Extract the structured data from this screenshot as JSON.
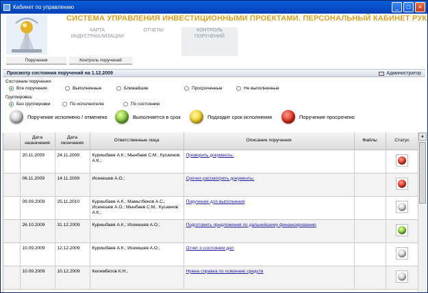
{
  "window": {
    "title": "Кабинет по управлению",
    "min": "_",
    "max": "□",
    "close": "×"
  },
  "header": {
    "app_title": "СИСТЕМА УПРАВЛЕНИЯ ИНВЕСТИЦИОННЫМИ ПРОЕКТАМИ. ПЕРСОНАЛЬНЫЙ КАБИНЕТ РУКОВОДИТЕЛЯ",
    "nav": [
      {
        "label_line1": "КАРТА",
        "label_line2": "ИНДУСТРИАЛИЗАЦИИ",
        "active": false
      },
      {
        "label_line1": "ОТЧЕТЫ",
        "label_line2": "",
        "active": false
      },
      {
        "label_line1": "КОНТРОЛЬ",
        "label_line2": "ПОРУЧЕНИЙ",
        "active": true
      }
    ]
  },
  "subtabs": [
    {
      "label": "Поручения"
    },
    {
      "label": "Контроль поручений"
    }
  ],
  "panel": {
    "title": "Просмотр состояния поручений на 1.12.2009",
    "user": "Администратор"
  },
  "state_filter": {
    "label": "Состояние поручения:",
    "options": [
      {
        "label": "Все поручения",
        "selected": true
      },
      {
        "label": "Выполненные",
        "selected": false
      },
      {
        "label": "Ближайшие",
        "selected": false
      },
      {
        "label": "Просроченные",
        "selected": false
      },
      {
        "label": "Не выполненные",
        "selected": false
      }
    ]
  },
  "grouping": {
    "label": "Группировка:",
    "options": [
      {
        "label": "Без группировки",
        "selected": true
      },
      {
        "label": "По исполнителю",
        "selected": false
      },
      {
        "label": "По состоянию",
        "selected": false
      }
    ]
  },
  "legend": [
    {
      "label": "Поручение исполнено / отменено",
      "color": "gray"
    },
    {
      "label": "Выполняется в срок",
      "color": "green"
    },
    {
      "label": "Подходит срок исполнения",
      "color": "yellow"
    },
    {
      "label": "Поручение просрочено",
      "color": "red"
    }
  ],
  "table": {
    "headers": {
      "col0": "",
      "col1_l1": "Дата",
      "col1_l2": "назначения",
      "col2_l1": "Дата",
      "col2_l2": "окончания",
      "col3": "Ответственные лица",
      "col4": "Описание поручения",
      "col5": "Файлы",
      "col6": "Статус"
    },
    "rows": [
      {
        "start": "20.11.2009",
        "end": "24.11.2009",
        "people": "Куришбаев А.К.; Мынбаев С.М.; Кусаинов А.К.;",
        "desc": "Проверить документы.",
        "files": "",
        "status": "red"
      },
      {
        "start": "06.11.2009",
        "end": "14.11.2009",
        "people": "Исекешев А.О.;",
        "desc": "Срочно рассмотреть документы.",
        "files": "",
        "status": "red"
      },
      {
        "start": "09.09.2009",
        "end": "25.11.2010",
        "people": "Куришбаев А.К.; Мамытбеков А.С.; Исекешев А.О.; Мынбаев С.М.; Кусаинов А.К.;",
        "desc": "Поручение для выполнения",
        "files": "",
        "status": "gray"
      },
      {
        "start": "26.10.2009",
        "end": "31.12.2009",
        "people": "Куришбаев А.К.; Исекешев А.О.;",
        "desc": "Подготовить предложения по дальнейшему финансированию",
        "files": "",
        "status": "green"
      },
      {
        "start": "10.09.2009",
        "end": "12.12.2009",
        "people": "Куришбаев А.К.; Исекешев А.О.;",
        "desc": "Отчет о состоянии дел",
        "files": "",
        "status": "gray"
      },
      {
        "start": "10.09.2009",
        "end": "10.12.2009",
        "people": "Келимбетов К.Н.;",
        "desc": "Нужна справка по освоению средств",
        "files": "",
        "status": "gray"
      }
    ]
  }
}
